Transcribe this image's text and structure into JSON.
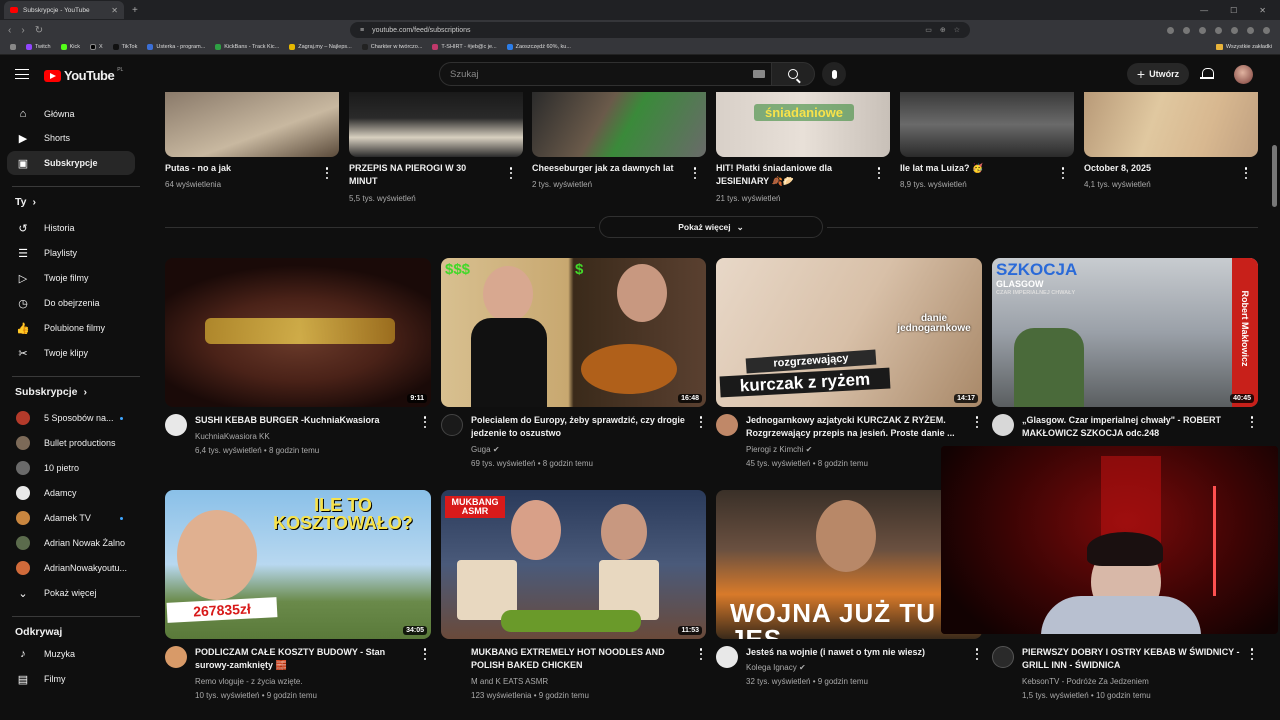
{
  "browser": {
    "tab_title": "Subskrypcje - YouTube",
    "url": "youtube.com/feed/subscriptions",
    "bookmarks": [
      "Twitch",
      "Kick",
      "X",
      "TikTok",
      "Usterka - program...",
      "KickBans - Track Kic...",
      "Zagraj.my – Najleps...",
      "Charkter w twórczo...",
      "T-SHIRT - #jeb@c je...",
      "Zaoszczędź 60%, ku..."
    ],
    "bookmarks_right": "Wszystkie zakładki"
  },
  "header": {
    "logo_text": "YouTube",
    "country_code": "PL",
    "search_placeholder": "Szukaj",
    "create_label": "Utwórz"
  },
  "sidebar": {
    "main": [
      {
        "label": "Główna",
        "icon": "home-icon"
      },
      {
        "label": "Shorts",
        "icon": "shorts-icon"
      },
      {
        "label": "Subskrypcje",
        "icon": "subscriptions-icon"
      }
    ],
    "you_heading": "Ty",
    "you_items": [
      {
        "label": "Historia",
        "icon": "history-icon"
      },
      {
        "label": "Playlisty",
        "icon": "playlists-icon"
      },
      {
        "label": "Twoje filmy",
        "icon": "your-videos-icon"
      },
      {
        "label": "Do obejrzenia",
        "icon": "watch-later-icon"
      },
      {
        "label": "Polubione filmy",
        "icon": "liked-icon"
      },
      {
        "label": "Twoje klipy",
        "icon": "clips-icon"
      }
    ],
    "subs_heading": "Subskrypcje",
    "subs": [
      {
        "label": "5 Sposobów na...",
        "color": "#b33a2a",
        "dot": true
      },
      {
        "label": "Bullet productions",
        "color": "#7c6a58",
        "dot": false
      },
      {
        "label": "10 pietro",
        "color": "#6a6a6a",
        "dot": false
      },
      {
        "label": "Adamcy",
        "color": "#e8e8e8",
        "dot": false
      },
      {
        "label": "Adamek TV",
        "color": "#c9863f",
        "dot": true
      },
      {
        "label": "Adrian Nowak Żalno",
        "color": "#5b6b4c",
        "dot": false
      },
      {
        "label": "AdrianNowakyoutu...",
        "color": "#d06a3a",
        "dot": false
      }
    ],
    "show_more": "Pokaż więcej",
    "explore_heading": "Odkrywaj",
    "explore": [
      {
        "label": "Muzyka",
        "icon": "music-icon"
      },
      {
        "label": "Filmy",
        "icon": "movies-icon"
      }
    ]
  },
  "top_row": [
    {
      "title": "Putas - no a jak",
      "meta": "64 wyświetlenia"
    },
    {
      "title": "PRZEPIS NA PIEROGI W 30 MINUT",
      "meta": "5,5 tys. wyświetleń"
    },
    {
      "title": "Cheeseburger jak za dawnych lat",
      "meta": "2 tys. wyświetleń"
    },
    {
      "title": "HIT! Płatki śniadaniowe dla JESIENIARY 🍂🥟",
      "meta": "21 tys. wyświetleń",
      "overlay": "śniadaniowe"
    },
    {
      "title": "Ile lat ma Luiza? 🥳",
      "meta": "8,9 tys. wyświetleń"
    },
    {
      "title": "October 8, 2025",
      "meta": "4,1 tys. wyświetleń"
    }
  ],
  "show_more_button": "Pokaż więcej",
  "row2": [
    {
      "title": "SUSHI KEBAB BURGER -KuchniaKwasiora",
      "channel": "KuchniaKwasiora KK",
      "verified": false,
      "meta": "6,4 tys. wyświetleń • 8 godzin temu",
      "duration": "9:11"
    },
    {
      "title": "Polecialem do Europy, żeby sprawdzić, czy drogie jedzenie to oszustwo",
      "channel": "Guga",
      "verified": true,
      "meta": "69 tys. wyświetleń • 8 godzin temu",
      "duration": "16:48",
      "overlay_left": "$$$",
      "overlay_right": "$"
    },
    {
      "title": "Jednogarnkowy azjatycki KURCZAK Z RYŻEM. Rozgrzewający przepis na jesień. Proste danie ...",
      "channel": "Pierogi z Kimchi",
      "verified": true,
      "meta": "45 tys. wyświetleń • 8 godzin temu",
      "duration": "14:17",
      "overlay_top": "danie jednogarnkowe",
      "overlay_mid": "rozgrzewający",
      "overlay_big": "kurczak z ryżem"
    },
    {
      "title": "„Glasgow. Czar imperialnej chwały\" - ROBERT MAKŁOWICZ SZKOCJA odc.248",
      "channel": "",
      "verified": false,
      "meta": "",
      "duration": "40:45",
      "overlay_big": "SZKOCJA",
      "overlay_small": "GLASGOW",
      "overlay_tiny": "CZAR IMPERIALNEJ CHWAŁY",
      "overlay_side": "Robert Makłowicz"
    }
  ],
  "row3": [
    {
      "title": "PODLICZAM CAŁE KOSZTY BUDOWY - Stan surowy-zamknięty 🧱",
      "channel": "Remo vloguje - z życia wzięte.",
      "verified": false,
      "meta": "10 tys. wyświetleń • 9 godzin temu",
      "duration": "34:05",
      "overlay_big": "ILE TO KOSZTOWAŁO?",
      "overlay_sign": "267835zł"
    },
    {
      "title": "MUKBANG EXTREMELY HOT NOODLES AND POLISH BAKED CHICKEN",
      "channel": "M and K EATS ASMR",
      "verified": false,
      "meta": "123 wyświetlenia • 9 godzin temu",
      "duration": "11:53",
      "overlay_badge": "MUKBANG ASMR"
    },
    {
      "title": "Jesteś na wojnie (i nawet o tym nie wiesz)",
      "channel": "Kolega Ignacy",
      "verified": true,
      "meta": "32 tys. wyświetleń • 9 godzin temu",
      "duration": "",
      "overlay_big": "WOJNA JUŻ TU JES"
    },
    {
      "title": "PIERWSZY DOBRY I OSTRY KEBAB W ŚWIDNICY - GRILL INN - ŚWIDNICA",
      "channel": "KebsonTV - Podróże Za Jedzeniem",
      "verified": false,
      "meta": "1,5 tys. wyświetleń • 10 godzin temu",
      "duration": ""
    }
  ]
}
